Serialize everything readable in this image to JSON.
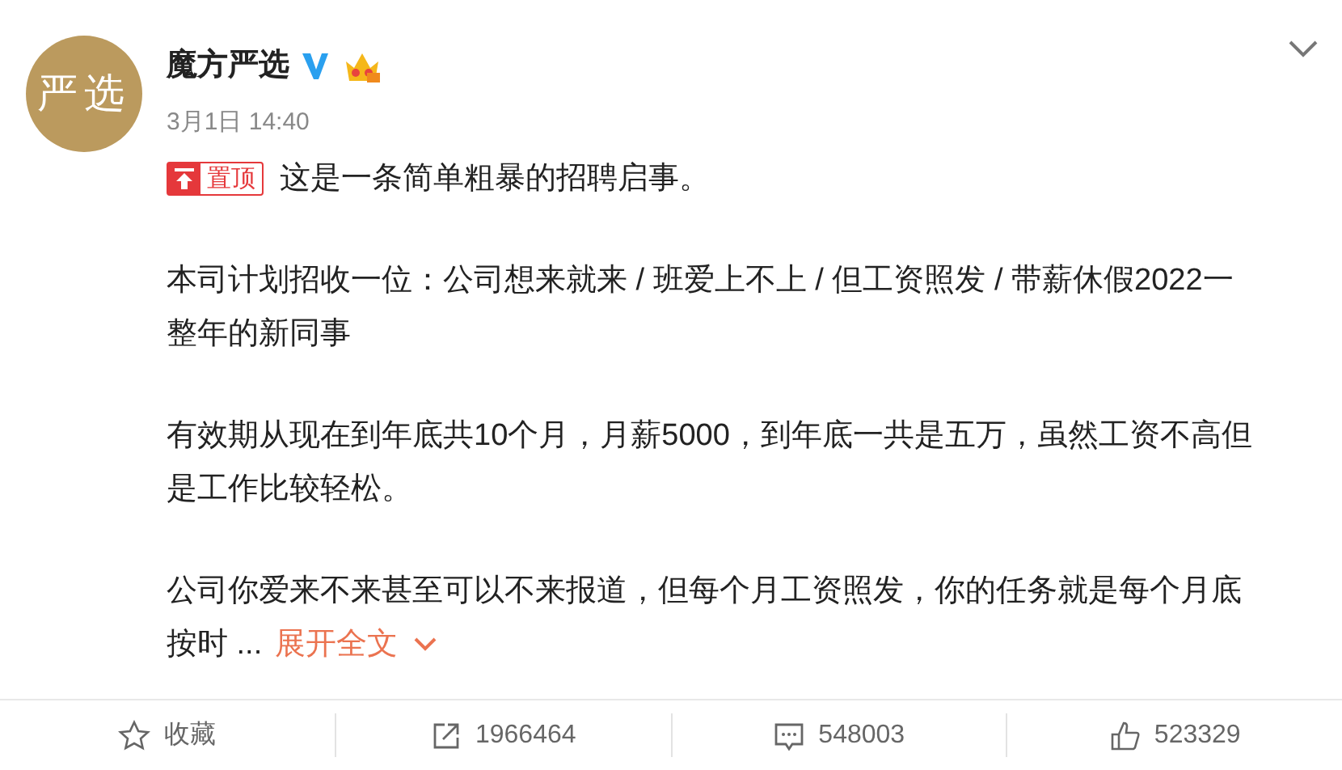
{
  "post": {
    "avatar_text": "严选",
    "author": "魔方严选",
    "verified": true,
    "time": "3月1日 14:40",
    "pinned_label": "置顶",
    "paragraphs": [
      [
        "这是一条简单粗暴的招聘启事。"
      ],
      [
        "本司计划招收一位：公司想来就来 / 班爱上不上 / 但工资照发 / 带薪休假2022一",
        "整年的新同事"
      ],
      [
        "有效期从现在到年底共10个月，月薪5000，到年底一共是五万，虽然工资不高但",
        "是工作比较轻松。"
      ],
      [
        "公司你爱来不来甚至可以不来报道，但每个月工资照发，你的任务就是每个月底",
        "按时 ..."
      ]
    ],
    "expand_link": "展开全文"
  },
  "actions": [
    {
      "kind": "favorite",
      "label": "收藏"
    },
    {
      "kind": "share",
      "label": "1966464"
    },
    {
      "kind": "comment",
      "label": "548003"
    },
    {
      "kind": "like",
      "label": "523329"
    }
  ]
}
